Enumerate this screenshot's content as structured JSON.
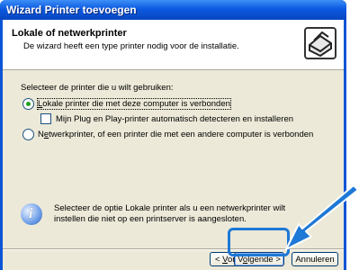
{
  "window": {
    "title": "Wizard Printer toevoegen"
  },
  "header": {
    "title": "Lokale of netwerkprinter",
    "subtitle": "De wizard heeft een type printer nodig voor de installatie."
  },
  "main": {
    "prompt": "Selecteer de printer die u wilt gebruiken:",
    "option_local": {
      "prefix": "",
      "accel": "L",
      "rest": "okale printer die met deze computer is verbonden",
      "selected": true
    },
    "option_pnp": {
      "label": "Mijn Plug en Play-printer automatisch detecteren en installeren",
      "checked": false
    },
    "option_network": {
      "prefix": "N",
      "accel": "e",
      "rest": "twerkprinter, of een printer die met een andere computer is verbonden",
      "selected": false
    },
    "info_text": "Selecteer de optie Lokale printer als u een netwerkprinter wilt instellen die niet op een printserver is aangesloten."
  },
  "buttons": {
    "back": {
      "prefix": "< ",
      "accel": "V",
      "rest": "orige"
    },
    "next": {
      "prefix": "V",
      "accel": "o",
      "rest": "lgende >"
    },
    "cancel": "Annuleren"
  },
  "colors": {
    "title_bar": "#0c5ae0",
    "dialog_bg": "#ece9d8",
    "callout": "#1e78d6"
  }
}
